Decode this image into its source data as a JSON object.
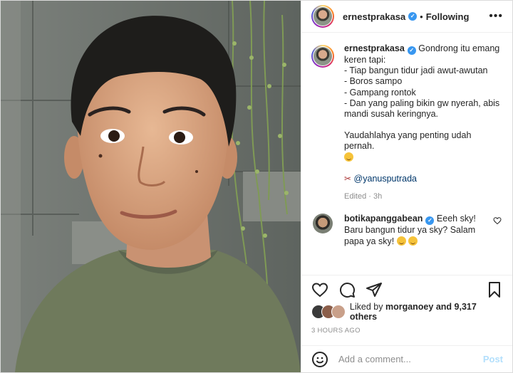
{
  "header": {
    "username": "ernestprakasa",
    "separator": "•",
    "follow_status": "Following",
    "more_icon": "more-horizontal-icon"
  },
  "caption": {
    "username": "ernestprakasa",
    "lines": [
      "Gondrong itu emang",
      "keren tapi:",
      "- Tiap bangun tidur jadi awut-awutan",
      "- Boros sampo",
      "- Gampang rontok",
      "- Dan yang paling bikin gw nyerah, abis",
      "mandi susah keringnya."
    ],
    "closing": "Yaudahlahya yang penting udah pernah.",
    "mention": "@yanusputrada",
    "meta": "Edited · 3h"
  },
  "comment": {
    "username": "botikapanggabean",
    "text_1": "Eeeh sky!",
    "text_2": "Baru bangun tidur ya sky? Salam",
    "text_3": "papa ya sky!"
  },
  "likes": {
    "prefix": "Liked by",
    "user": "morganoey",
    "suffix": "and 9,317 others"
  },
  "timestamp": "3 HOURS AGO",
  "add_comment": {
    "placeholder": "Add a comment...",
    "post_label": "Post"
  },
  "colors": {
    "verified": "#3897f0",
    "mention": "#00376b",
    "post_disabled": "#b2dffc"
  }
}
